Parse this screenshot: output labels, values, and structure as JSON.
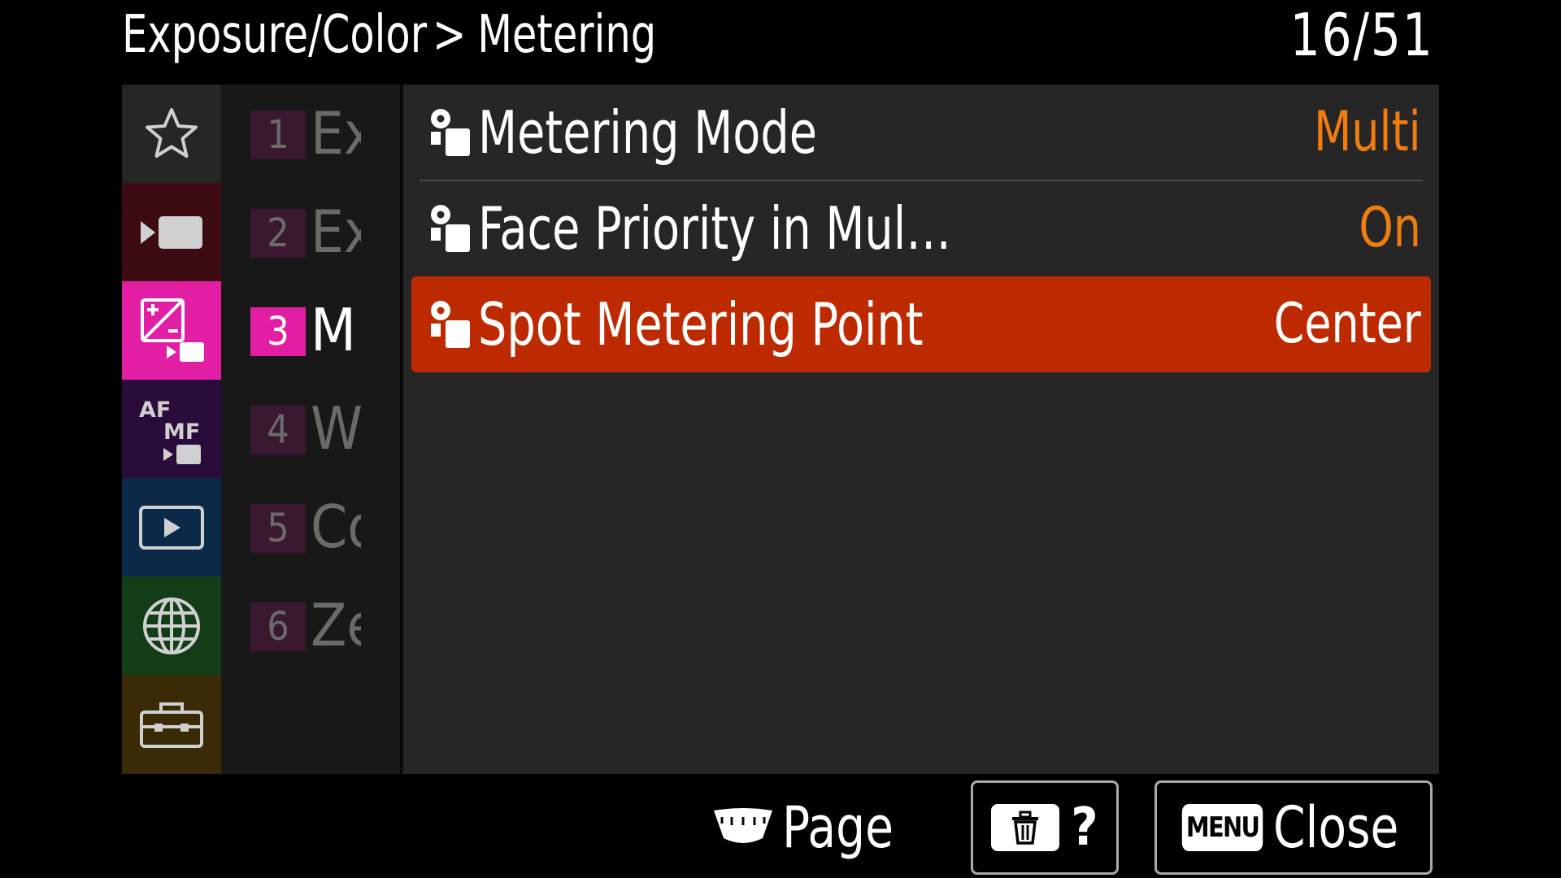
{
  "header": {
    "category": "Exposure/Color",
    "separator": ">",
    "section": "Metering",
    "page_indicator": "16/51"
  },
  "category_tabs": [
    {
      "name": "favorites",
      "icon": "star-icon",
      "color": "#262626"
    },
    {
      "name": "shooting",
      "icon": "shooting-camera-icon",
      "color": "#3d0b12"
    },
    {
      "name": "exposure-color",
      "icon": "exposure-color-icon",
      "color": "#e21ea4",
      "active": true
    },
    {
      "name": "focus",
      "icon": "af-mf-icon",
      "color": "#2a0c3a"
    },
    {
      "name": "playback",
      "icon": "playback-icon",
      "color": "#0b2a4a"
    },
    {
      "name": "network",
      "icon": "globe-icon",
      "color": "#123d17"
    },
    {
      "name": "setup",
      "icon": "toolbox-icon",
      "color": "#3b2a06"
    }
  ],
  "sub_items": [
    {
      "num": "1",
      "label": "Ex"
    },
    {
      "num": "2",
      "label": "Ex"
    },
    {
      "num": "3",
      "label": "M",
      "active": true
    },
    {
      "num": "4",
      "label": "W"
    },
    {
      "num": "5",
      "label": "Co"
    },
    {
      "num": "6",
      "label": "Ze"
    }
  ],
  "menu_items": [
    {
      "label": "Metering Mode",
      "value": "Multi"
    },
    {
      "label": "Face Priority in Mul…",
      "value": "On"
    },
    {
      "label": "Spot Metering Point",
      "value": "Center",
      "selected": true
    }
  ],
  "footer": {
    "page_label": "Page",
    "help_label": "?",
    "menu_badge": "MENU",
    "close_label": "Close"
  },
  "colors": {
    "accent_value": "#f07d0e",
    "selected_row": "#be2a00",
    "active_tab": "#e21ea4"
  }
}
